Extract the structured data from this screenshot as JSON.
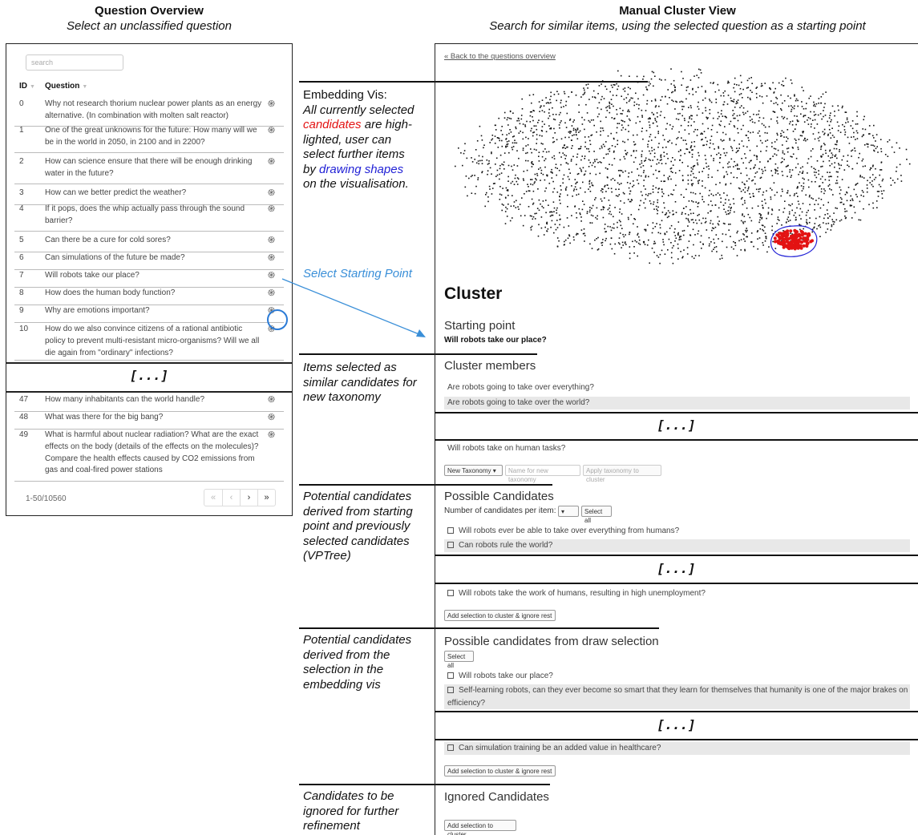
{
  "headings": {
    "left_title": "Question Overview",
    "left_subtitle": "Select an unclassified question",
    "right_title": "Manual Cluster View",
    "right_subtitle": "Search for similar items, using the selected question as a starting point"
  },
  "overview": {
    "search_placeholder": "search",
    "col_id": "ID",
    "col_question": "Question",
    "rows_top": [
      {
        "id": "0",
        "text": "Why not research thorium nuclear power plants as an energy alternative. (In combination with molten salt reactor)"
      },
      {
        "id": "1",
        "text": "One of the great unknowns for the future: How many will we be in the world in 2050, in 2100 and in 2200?"
      },
      {
        "id": "2",
        "text": "How can science ensure that there will be enough drinking water in the future?"
      },
      {
        "id": "3",
        "text": "How can we better predict the weather?"
      },
      {
        "id": "4",
        "text": "If it pops, does the whip actually pass through the sound barrier?"
      },
      {
        "id": "5",
        "text": "Can there be a cure for cold sores?"
      },
      {
        "id": "6",
        "text": "Can simulations of the future be made?"
      },
      {
        "id": "7",
        "text": "Will robots take our place?"
      },
      {
        "id": "8",
        "text": "How does the human body function?"
      },
      {
        "id": "9",
        "text": "Why are emotions important?"
      },
      {
        "id": "10",
        "text": "How do we also convince citizens of a rational antibiotic policy to prevent multi-resistant micro-organisms? Will we all die again from \"ordinary\" infections?"
      }
    ],
    "ellipsis": "[...]",
    "rows_bottom": [
      {
        "id": "47",
        "text": "How many inhabitants can the world handle?"
      },
      {
        "id": "48",
        "text": "What was there for the big bang?"
      },
      {
        "id": "49",
        "text": "What is harmful about nuclear radiation? What are the exact effects on the body (details of the effects on the molecules)? Compare the health effects caused by CO2 emissions from gas and coal-fired power stations"
      }
    ],
    "pager_text": "1-50/10560",
    "pager_buttons": [
      "«",
      "‹",
      "›",
      "»"
    ],
    "icon": "fingerprint-icon"
  },
  "annotations": {
    "embed_title": "Embedding Vis:",
    "embed_l1": "All currently selected",
    "embed_red": "candidates",
    "embed_l2_rest": " are high-",
    "embed_l3": "lighted, user can",
    "embed_l4": "select further items",
    "embed_l5_pre": "by ",
    "embed_blue": "drawing shapes",
    "embed_l6": "on the visualisation.",
    "select_start": "Select Starting Point",
    "items_selected": [
      "Items selected as",
      "similar candidates for",
      "new taxonomy"
    ],
    "potential_vp": [
      "Potential candidates",
      "derived from starting",
      "point and previously",
      "selected candidates",
      "(VPTree)"
    ],
    "potential_draw": [
      "Potential candidates",
      "derived from the",
      "selection in the",
      "embedding vis"
    ],
    "ignored": [
      "Candidates to be",
      "ignored for further",
      "refinement"
    ]
  },
  "cluster_view": {
    "back_link": "« Back to the questions overview",
    "cluster_heading": "Cluster",
    "starting_point_label": "Starting point",
    "starting_point_value": "Will robots take our place?",
    "members_label": "Cluster members",
    "members": [
      "Are robots going to take over everything?",
      "Are robots going to take over the world?"
    ],
    "members_last": "Will robots take on human tasks?",
    "ellipsis": "[...]",
    "taxonomy_select": "New Taxonomy",
    "taxonomy_name_placeholder": "Name for new taxonomy",
    "apply_button": "Apply taxonomy to cluster",
    "possible_label": "Possible Candidates",
    "per_item_label": "Number of candidates per item:",
    "select_all": "Select all",
    "possible": [
      "Will robots ever be able to take over everything from humans?",
      "Can robots rule the world?"
    ],
    "possible_last": "Will robots take the work of humans, resulting in high unemployment?",
    "add_ignore_button": "Add selection to cluster & ignore rest",
    "draw_label": "Possible candidates from draw selection",
    "draw_select_all": "Select all",
    "draw": [
      "Will robots take our place?",
      "Self-learning robots, can they ever become so smart that they learn for themselves that humanity is one of the major brakes on efficiency?"
    ],
    "draw_last": "Can simulation training be an added value in healthcare?",
    "draw_add_ignore_button": "Add selection to cluster & ignore rest",
    "ignored_label": "Ignored Candidates",
    "add_to_cluster_button": "Add selection to cluster"
  },
  "colors": {
    "highlight_red": "#e31313",
    "draw_blue": "#2323d6",
    "arrow_blue": "#3a8fd8"
  }
}
